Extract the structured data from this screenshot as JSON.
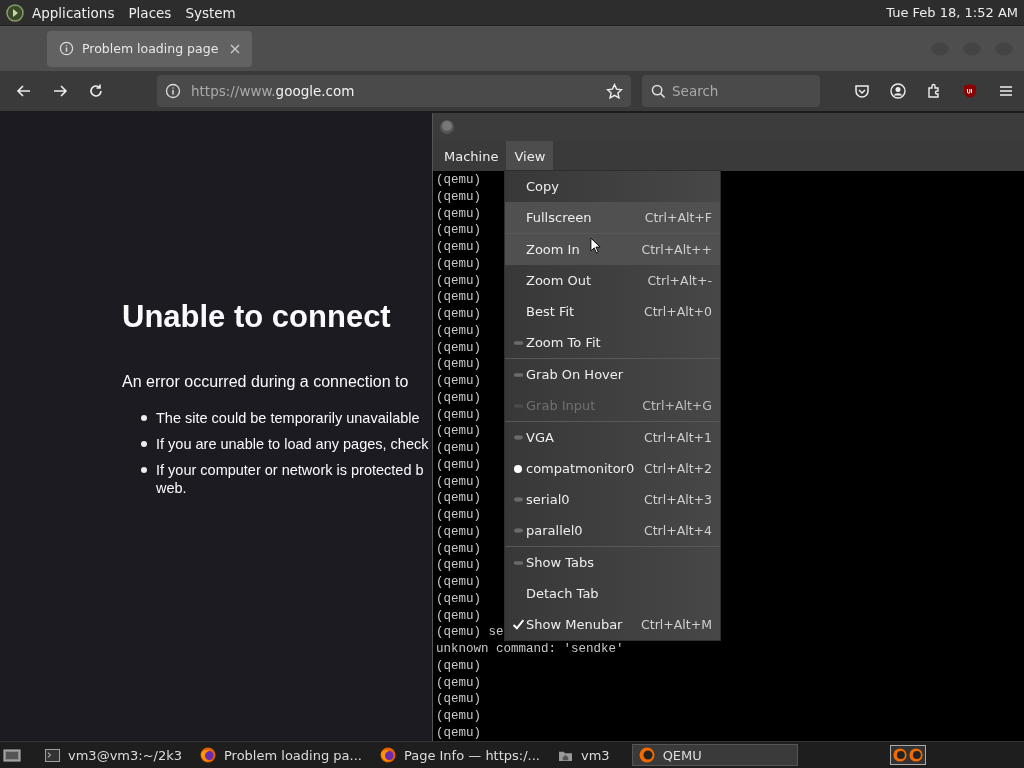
{
  "top_panel": {
    "menus": [
      "Applications",
      "Places",
      "System"
    ],
    "clock": "Tue Feb 18, 1:52 AM"
  },
  "browser": {
    "tabs": [
      {
        "title": "Problem loading page",
        "selected": true
      }
    ],
    "url": "https://www.**google.com**",
    "search": {
      "placeholder": "Search"
    }
  },
  "error_page": {
    "title": "Unable to connect",
    "intro": "An error occurred during a connection to",
    "bullets": [
      {
        "lines": [
          "The site could be temporarily unavailable"
        ]
      },
      {
        "lines": [
          "If you are unable to load any pages, check"
        ]
      },
      {
        "lines": [
          "If your computer or network is protected b",
          "web."
        ]
      }
    ]
  },
  "qemu": {
    "menubar": [
      {
        "label": "Machine",
        "selected": false
      },
      {
        "label": "View",
        "selected": true
      }
    ],
    "console": [
      "(qemu)",
      "(qemu)",
      "(qemu)",
      "(qemu)",
      "(qemu)",
      "(qemu)",
      "(qemu)",
      "(qemu)",
      "(qemu)",
      "(qemu)",
      "(qemu)",
      "(qemu)",
      "(qemu)",
      "(qemu)",
      "(qemu)",
      "(qemu)",
      "(qemu)",
      "(qemu)",
      "(qemu)",
      "(qemu)",
      "(qemu)",
      "(qemu)",
      "(qemu)",
      "(qemu)",
      "(qemu)",
      "(qemu)",
      "(qemu)",
      "(qemu) se",
      "unknown command: 'sendke'",
      "(qemu)",
      "(qemu)",
      "(qemu)",
      "(qemu)",
      "(qemu)"
    ],
    "menu": {
      "sections": [
        {
          "items": [
            {
              "label": "Copy",
              "kind": "plain",
              "highlighted": false
            },
            {
              "label": "Fullscreen",
              "shortcut": "Ctrl+Alt+F",
              "kind": "plain",
              "highlighted": true
            }
          ]
        },
        {
          "items": [
            {
              "label": "Zoom In",
              "shortcut": "Ctrl+Alt++",
              "kind": "plain",
              "highlighted": true
            },
            {
              "label": "Zoom Out",
              "shortcut": "Ctrl+Alt+-",
              "kind": "plain",
              "highlighted": false
            },
            {
              "label": "Best Fit",
              "shortcut": "Ctrl+Alt+0",
              "kind": "plain",
              "highlighted": false
            },
            {
              "label": "Zoom To Fit",
              "kind": "check",
              "checked": false,
              "highlighted": false
            }
          ]
        },
        {
          "items": [
            {
              "label": "Grab On Hover",
              "kind": "check",
              "checked": false,
              "highlighted": false
            },
            {
              "label": "Grab Input",
              "shortcut": "Ctrl+Alt+G",
              "kind": "check",
              "checked": false,
              "disabled": true,
              "highlighted": false
            }
          ]
        },
        {
          "items": [
            {
              "label": "VGA",
              "shortcut": "Ctrl+Alt+1",
              "kind": "radio",
              "checked": false,
              "highlighted": false
            },
            {
              "label": "compatmonitor0",
              "shortcut": "Ctrl+Alt+2",
              "kind": "radio",
              "checked": true,
              "highlighted": false
            },
            {
              "label": "serial0",
              "shortcut": "Ctrl+Alt+3",
              "kind": "radio",
              "checked": false,
              "highlighted": false
            },
            {
              "label": "parallel0",
              "shortcut": "Ctrl+Alt+4",
              "kind": "radio",
              "checked": false,
              "highlighted": false
            }
          ]
        },
        {
          "items": [
            {
              "label": "Show Tabs",
              "kind": "check",
              "checked": false,
              "highlighted": false
            },
            {
              "label": "Detach Tab",
              "kind": "plain",
              "highlighted": false
            },
            {
              "label": "Show Menubar",
              "shortcut": "Ctrl+Alt+M",
              "kind": "check",
              "checked": true,
              "highlighted": false
            }
          ]
        }
      ]
    }
  },
  "taskbar": {
    "items": [
      {
        "label": "vm3@vm3:~/2k3",
        "kind": "terminal",
        "selected": false
      },
      {
        "label": "Problem loading pa...",
        "kind": "firefox",
        "selected": false
      },
      {
        "label": "Page Info — https:/...",
        "kind": "firefox",
        "selected": false
      },
      {
        "label": "vm3",
        "kind": "folder",
        "selected": false
      },
      {
        "label": "QEMU",
        "kind": "qemu",
        "selected": true
      }
    ]
  }
}
